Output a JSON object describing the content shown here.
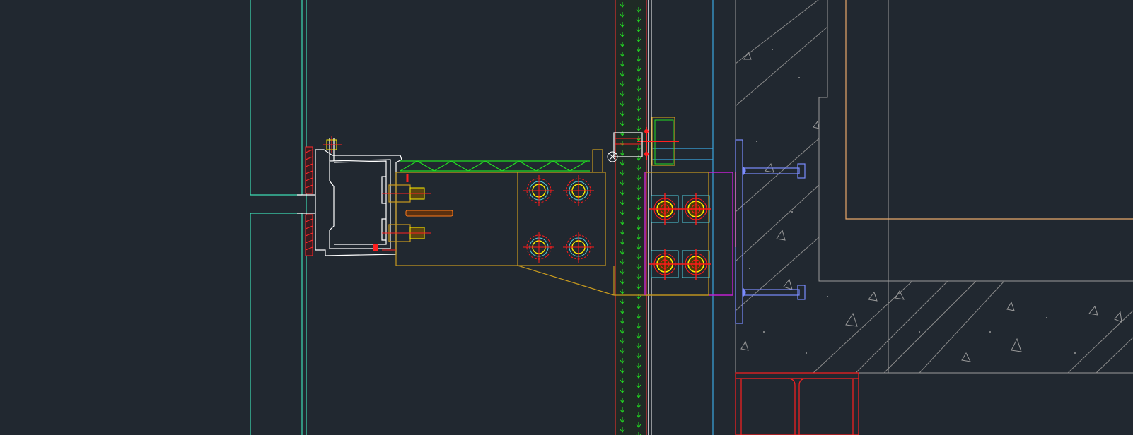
{
  "view": {
    "type": "cad-section-detail",
    "background": "#212830",
    "has_text_labels": false
  },
  "colors": {
    "background": "#212830",
    "mullion_outline": "#ffffff",
    "panel_edge": "#3ddbb4",
    "brackets": "#c89a1e",
    "bolts": "#ffee00",
    "cut_marks": "#ff1a1a",
    "insulation": "#22dd22",
    "insulation_strip": "#1b6b2a",
    "embed_plate": "#7b8cff",
    "anchor_plate": "#c020d0",
    "structure": "#9a9a9a",
    "concrete_edge": "#aaaaaa",
    "face_line": "#3aa6df",
    "column_outline": "#e8a76a",
    "steel_beam": "#ff2020",
    "bolt_rings": "#4fd0e0"
  },
  "components": [
    "glass-panel",
    "aluminium-mullion",
    "steel-bracket",
    "bolt-group",
    "insulated-wall",
    "embed-plate",
    "anchor-bolt",
    "concrete-slab",
    "concrete-column",
    "steel-beam"
  ]
}
